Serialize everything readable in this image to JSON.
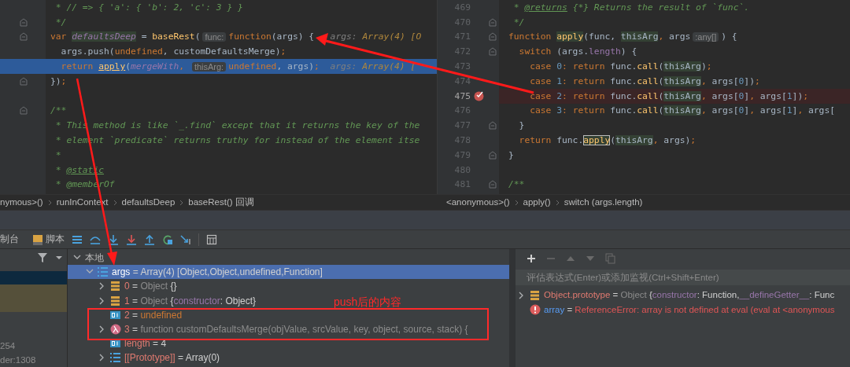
{
  "left_editor": {
    "lines": [
      {
        "tokens": [
          {
            "text": " * // => { 'a': { 'b': 2, 'c': 3 } }",
            "kind": "comment"
          }
        ]
      },
      {
        "fold": true,
        "tokens": [
          {
            "text": " */",
            "kind": "comment"
          }
        ]
      },
      {
        "fold": true,
        "tokens": [
          {
            "text": "var ",
            "kind": "keyword"
          },
          {
            "text": "defaultsDeep",
            "kind": "decl-highlight"
          },
          {
            "text": " = ",
            "kind": "plain"
          },
          {
            "text": "baseRest",
            "kind": "function"
          },
          {
            "text": "(",
            "kind": "plain"
          },
          {
            "text": "func:",
            "kind": "hint"
          },
          {
            "text": "function",
            "kind": "keyword"
          },
          {
            "text": "(args) {   ",
            "kind": "plain"
          },
          {
            "text": "args: ",
            "kind": "debug-name"
          },
          {
            "text": "Array(4) [O",
            "kind": "debug-value"
          }
        ]
      },
      {
        "tokens": [
          {
            "text": "  args.push(",
            "kind": "plain"
          },
          {
            "text": "undefined",
            "kind": "keyword"
          },
          {
            "text": ", customDefaultsMerge)",
            "kind": "plain"
          },
          {
            "text": ";",
            "kind": "keyword"
          }
        ]
      },
      {
        "current": true,
        "tokens": [
          {
            "text": "  return ",
            "kind": "keyword"
          },
          {
            "text": "apply",
            "kind": "function-underlined"
          },
          {
            "text": "(",
            "kind": "plain"
          },
          {
            "text": "mergeWith",
            "kind": "global"
          },
          {
            "text": ", ",
            "kind": "keyword"
          },
          {
            "text": "thisArg:",
            "kind": "hint"
          },
          {
            "text": "undefined",
            "kind": "keyword"
          },
          {
            "text": ", args)",
            "kind": "plain"
          },
          {
            "text": ";  ",
            "kind": "keyword"
          },
          {
            "text": "args: ",
            "kind": "debug-name"
          },
          {
            "text": "Array(4) [",
            "kind": "debug-value"
          }
        ]
      },
      {
        "fold": true,
        "tokens": [
          {
            "text": "})",
            "kind": "plain"
          },
          {
            "text": ";",
            "kind": "keyword"
          }
        ]
      },
      {
        "fold": false
      },
      {
        "fold": true,
        "tokens": [
          {
            "text": "/**",
            "kind": "comment"
          }
        ]
      },
      {
        "tokens": [
          {
            "text": " * This method is like `_.find` except that it returns the key of the",
            "kind": "comment"
          }
        ]
      },
      {
        "tokens": [
          {
            "text": " * element `predicate` returns truthy for instead of the element itse",
            "kind": "comment"
          }
        ]
      },
      {
        "tokens": [
          {
            "text": " *",
            "kind": "comment"
          }
        ]
      },
      {
        "tokens": [
          {
            "text": " * ",
            "kind": "comment"
          },
          {
            "text": "@static",
            "kind": "comment-tag"
          }
        ]
      },
      {
        "tokens": [
          {
            "text": " * @memberOf",
            "kind": "comment"
          }
        ]
      }
    ]
  },
  "right_editor": {
    "lines": [
      {
        "number": "469",
        "breakpoint": false,
        "tokens": [
          {
            "text": " * ",
            "kind": "comment"
          },
          {
            "text": "@returns",
            "kind": "comment-tag"
          },
          {
            "text": " {*} Returns the result of `func`.",
            "kind": "comment"
          }
        ]
      },
      {
        "number": "470",
        "breakpoint": false,
        "fold": true,
        "tokens": [
          {
            "text": " */",
            "kind": "comment"
          }
        ]
      },
      {
        "number": "471",
        "breakpoint": false,
        "fold": true,
        "tokens": [
          {
            "text": "function ",
            "kind": "keyword"
          },
          {
            "text": "apply",
            "kind": "function-highlight"
          },
          {
            "text": "(func, ",
            "kind": "plain"
          },
          {
            "text": "thisArg",
            "kind": "param-highlight"
          },
          {
            "text": ", ",
            "kind": "keyword"
          },
          {
            "text": "args",
            "kind": "plain"
          },
          {
            "text": ":any[]",
            "kind": "hint"
          },
          {
            "text": ") {",
            "kind": "plain"
          }
        ]
      },
      {
        "number": "472",
        "breakpoint": false,
        "fold": true,
        "tokens": [
          {
            "text": "  switch ",
            "kind": "keyword"
          },
          {
            "text": "(args.",
            "kind": "plain"
          },
          {
            "text": "length",
            "kind": "field"
          },
          {
            "text": ") {",
            "kind": "plain"
          }
        ]
      },
      {
        "number": "473",
        "breakpoint": false,
        "tokens": [
          {
            "text": "    case ",
            "kind": "keyword"
          },
          {
            "text": "0",
            "kind": "number"
          },
          {
            "text": ": return ",
            "kind": "keyword"
          },
          {
            "text": "func.",
            "kind": "plain"
          },
          {
            "text": "call",
            "kind": "function"
          },
          {
            "text": "(",
            "kind": "plain"
          },
          {
            "text": "thisArg",
            "kind": "param-highlight"
          },
          {
            "text": ")",
            "kind": "plain"
          },
          {
            "text": ";",
            "kind": "keyword"
          }
        ]
      },
      {
        "number": "474",
        "breakpoint": false,
        "tokens": [
          {
            "text": "    case ",
            "kind": "keyword"
          },
          {
            "text": "1",
            "kind": "number"
          },
          {
            "text": ": return ",
            "kind": "keyword"
          },
          {
            "text": "func.",
            "kind": "plain"
          },
          {
            "text": "call",
            "kind": "function"
          },
          {
            "text": "(",
            "kind": "plain"
          },
          {
            "text": "thisArg",
            "kind": "param-highlight"
          },
          {
            "text": ", ",
            "kind": "keyword"
          },
          {
            "text": "args[",
            "kind": "plain"
          },
          {
            "text": "0",
            "kind": "number"
          },
          {
            "text": "])",
            "kind": "plain"
          },
          {
            "text": ";",
            "kind": "keyword"
          }
        ]
      },
      {
        "number": "475",
        "breakpoint": true,
        "tokens": [
          {
            "text": "    case ",
            "kind": "keyword"
          },
          {
            "text": "2",
            "kind": "number"
          },
          {
            "text": ": return ",
            "kind": "keyword"
          },
          {
            "text": "func.",
            "kind": "plain"
          },
          {
            "text": "call",
            "kind": "function"
          },
          {
            "text": "(",
            "kind": "plain"
          },
          {
            "text": "thisArg",
            "kind": "param-highlight"
          },
          {
            "text": ", ",
            "kind": "keyword"
          },
          {
            "text": "args[",
            "kind": "plain"
          },
          {
            "text": "0",
            "kind": "number"
          },
          {
            "text": "]",
            "kind": "plain"
          },
          {
            "text": ", ",
            "kind": "keyword"
          },
          {
            "text": "args[",
            "kind": "plain"
          },
          {
            "text": "1",
            "kind": "number"
          },
          {
            "text": "])",
            "kind": "plain"
          },
          {
            "text": ";",
            "kind": "keyword"
          }
        ]
      },
      {
        "number": "476",
        "breakpoint": false,
        "tokens": [
          {
            "text": "    case ",
            "kind": "keyword"
          },
          {
            "text": "3",
            "kind": "number"
          },
          {
            "text": ": return ",
            "kind": "keyword"
          },
          {
            "text": "func.",
            "kind": "plain"
          },
          {
            "text": "call",
            "kind": "function"
          },
          {
            "text": "(",
            "kind": "plain"
          },
          {
            "text": "thisArg",
            "kind": "param-highlight"
          },
          {
            "text": ", ",
            "kind": "keyword"
          },
          {
            "text": "args[",
            "kind": "plain"
          },
          {
            "text": "0",
            "kind": "number"
          },
          {
            "text": "]",
            "kind": "plain"
          },
          {
            "text": ", ",
            "kind": "keyword"
          },
          {
            "text": "args[",
            "kind": "plain"
          },
          {
            "text": "1",
            "kind": "number"
          },
          {
            "text": "]",
            "kind": "plain"
          },
          {
            "text": ", ",
            "kind": "keyword"
          },
          {
            "text": "args[",
            "kind": "plain"
          }
        ]
      },
      {
        "number": "477",
        "breakpoint": false,
        "fold": true,
        "tokens": [
          {
            "text": "  }",
            "kind": "plain"
          }
        ]
      },
      {
        "number": "478",
        "breakpoint": false,
        "tokens": [
          {
            "text": "  return ",
            "kind": "keyword"
          },
          {
            "text": "func.",
            "kind": "plain"
          },
          {
            "text": "apply",
            "kind": "function-boxed"
          },
          {
            "text": "(",
            "kind": "plain"
          },
          {
            "text": "thisArg",
            "kind": "param-highlight"
          },
          {
            "text": ", ",
            "kind": "keyword"
          },
          {
            "text": "args)",
            "kind": "plain"
          },
          {
            "text": ";",
            "kind": "keyword"
          }
        ]
      },
      {
        "number": "479",
        "breakpoint": false,
        "fold": true,
        "tokens": [
          {
            "text": "}",
            "kind": "plain"
          }
        ]
      },
      {
        "number": "480",
        "breakpoint": false
      },
      {
        "number": "481",
        "breakpoint": false,
        "fold": true,
        "tokens": [
          {
            "text": "/**",
            "kind": "comment"
          }
        ]
      }
    ]
  },
  "breadcrumbs_left": [
    "nymous>()",
    "runInContext",
    "defaultsDeep",
    "baseRest() 回调"
  ],
  "breadcrumbs_right": [
    "<anonymous>()",
    "apply()",
    "switch (args.length)"
  ],
  "debug_tabs": [
    {
      "label": "制台"
    },
    {
      "label": "脚本"
    }
  ],
  "frames": [
    {
      "selected": true
    },
    {
      "selected": false,
      "library": true
    },
    {
      "selected": false,
      "library": true
    },
    {
      "selected": false
    },
    {
      "selected": false
    },
    {
      "selected": false,
      "label": "254"
    },
    {
      "selected": false,
      "label": "der:1308"
    }
  ],
  "variables": [
    {
      "label": "本地",
      "expanded": true,
      "children": [
        {
          "kind": "array",
          "name": "args",
          "selected": true,
          "expanded": true,
          "value": [
            {
              "text": "= ",
              "kind": "plain"
            },
            {
              "text": "Array(4) [Object,Object,undefined,Function]",
              "kind": "plain"
            }
          ],
          "children": [
            {
              "kind": "object",
              "name": "0",
              "selected": false,
              "expanded": false,
              "value": [
                {
                  "text": "= ",
                  "kind": "plain"
                },
                {
                  "text": "Object ",
                  "kind": "type"
                },
                {
                  "text": "{}",
                  "kind": "plain"
                }
              ]
            },
            {
              "kind": "object",
              "name": "1",
              "selected": false,
              "expanded": false,
              "value": [
                {
                  "text": "= ",
                  "kind": "plain"
                },
                {
                  "text": "Object ",
                  "kind": "type"
                },
                {
                  "text": "{",
                  "kind": "plain"
                },
                {
                  "text": "constructor",
                  "kind": "property"
                },
                {
                  "text": ": Object}",
                  "kind": "plain"
                }
              ]
            },
            {
              "kind": "primitive",
              "name": "2",
              "selected": false,
              "value": [
                {
                  "text": "= ",
                  "kind": "plain"
                },
                {
                  "text": "undefined",
                  "kind": "undefined"
                }
              ]
            },
            {
              "kind": "function",
              "name": "3",
              "selected": false,
              "expanded": false,
              "value": [
                {
                  "text": "= ",
                  "kind": "plain"
                },
                {
                  "text": "function customDefaultsMerge(objValue, srcValue, key, object, source, stack) {",
                  "kind": "type"
                }
              ]
            },
            {
              "kind": "primitive",
              "name": "length",
              "selected": false,
              "value": [
                {
                  "text": "= ",
                  "kind": "plain"
                },
                {
                  "text": "4",
                  "kind": "plain"
                }
              ]
            },
            {
              "kind": "array",
              "name": "[[Prototype]]",
              "selected": false,
              "expanded": false,
              "value": [
                {
                  "text": "= ",
                  "kind": "plain"
                },
                {
                  "text": "Array(0)",
                  "kind": "plain"
                }
              ]
            }
          ]
        }
      ]
    }
  ],
  "watches": {
    "placeholder": "评估表达式(Enter)或添加监视(Ctrl+Shift+Enter)",
    "items": [
      {
        "kind": "object",
        "name": "Object.prototype",
        "expanded": false,
        "value": [
          {
            "text": "= ",
            "kind": "plain"
          },
          {
            "text": "Object ",
            "kind": "type"
          },
          {
            "text": "{",
            "kind": "plain"
          },
          {
            "text": "constructor",
            "kind": "property"
          },
          {
            "text": ": Function,",
            "kind": "plain"
          },
          {
            "text": "__defineGetter__",
            "kind": "property"
          },
          {
            "text": ": Func",
            "kind": "plain"
          }
        ]
      },
      {
        "kind": "error",
        "name": "array",
        "value": [
          {
            "text": "= ",
            "kind": "plain"
          },
          {
            "text": "ReferenceError: array is not defined    at eval (eval at <anonymous",
            "kind": "error"
          }
        ]
      }
    ]
  },
  "annotations": {
    "note": "push后的内容"
  }
}
